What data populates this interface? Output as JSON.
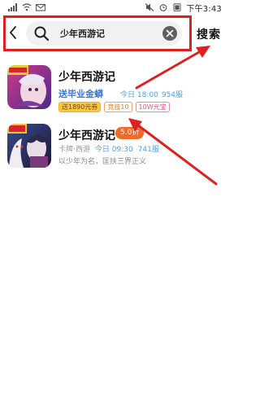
{
  "status_bar": {
    "time": "下午3:43"
  },
  "search": {
    "query": "少年西游记",
    "submit_label": "搜索"
  },
  "results": [
    {
      "title": "少年西游记",
      "promo": "送毕业金蟒",
      "time": "今日 18:00",
      "server": "954服",
      "tags": [
        "送1890元券",
        "竞技10",
        "10W元宝"
      ]
    },
    {
      "title": "少年西游记",
      "discount": "5.0折",
      "category": "卡牌·西游",
      "time": "今日 09:30",
      "server": "741服",
      "description": "以少年为名，匡扶三界正义"
    }
  ],
  "colors": {
    "highlight": "#e02020",
    "promo": "#3a77d4",
    "time": "#4aa3e8",
    "discount": "#f06a28"
  }
}
